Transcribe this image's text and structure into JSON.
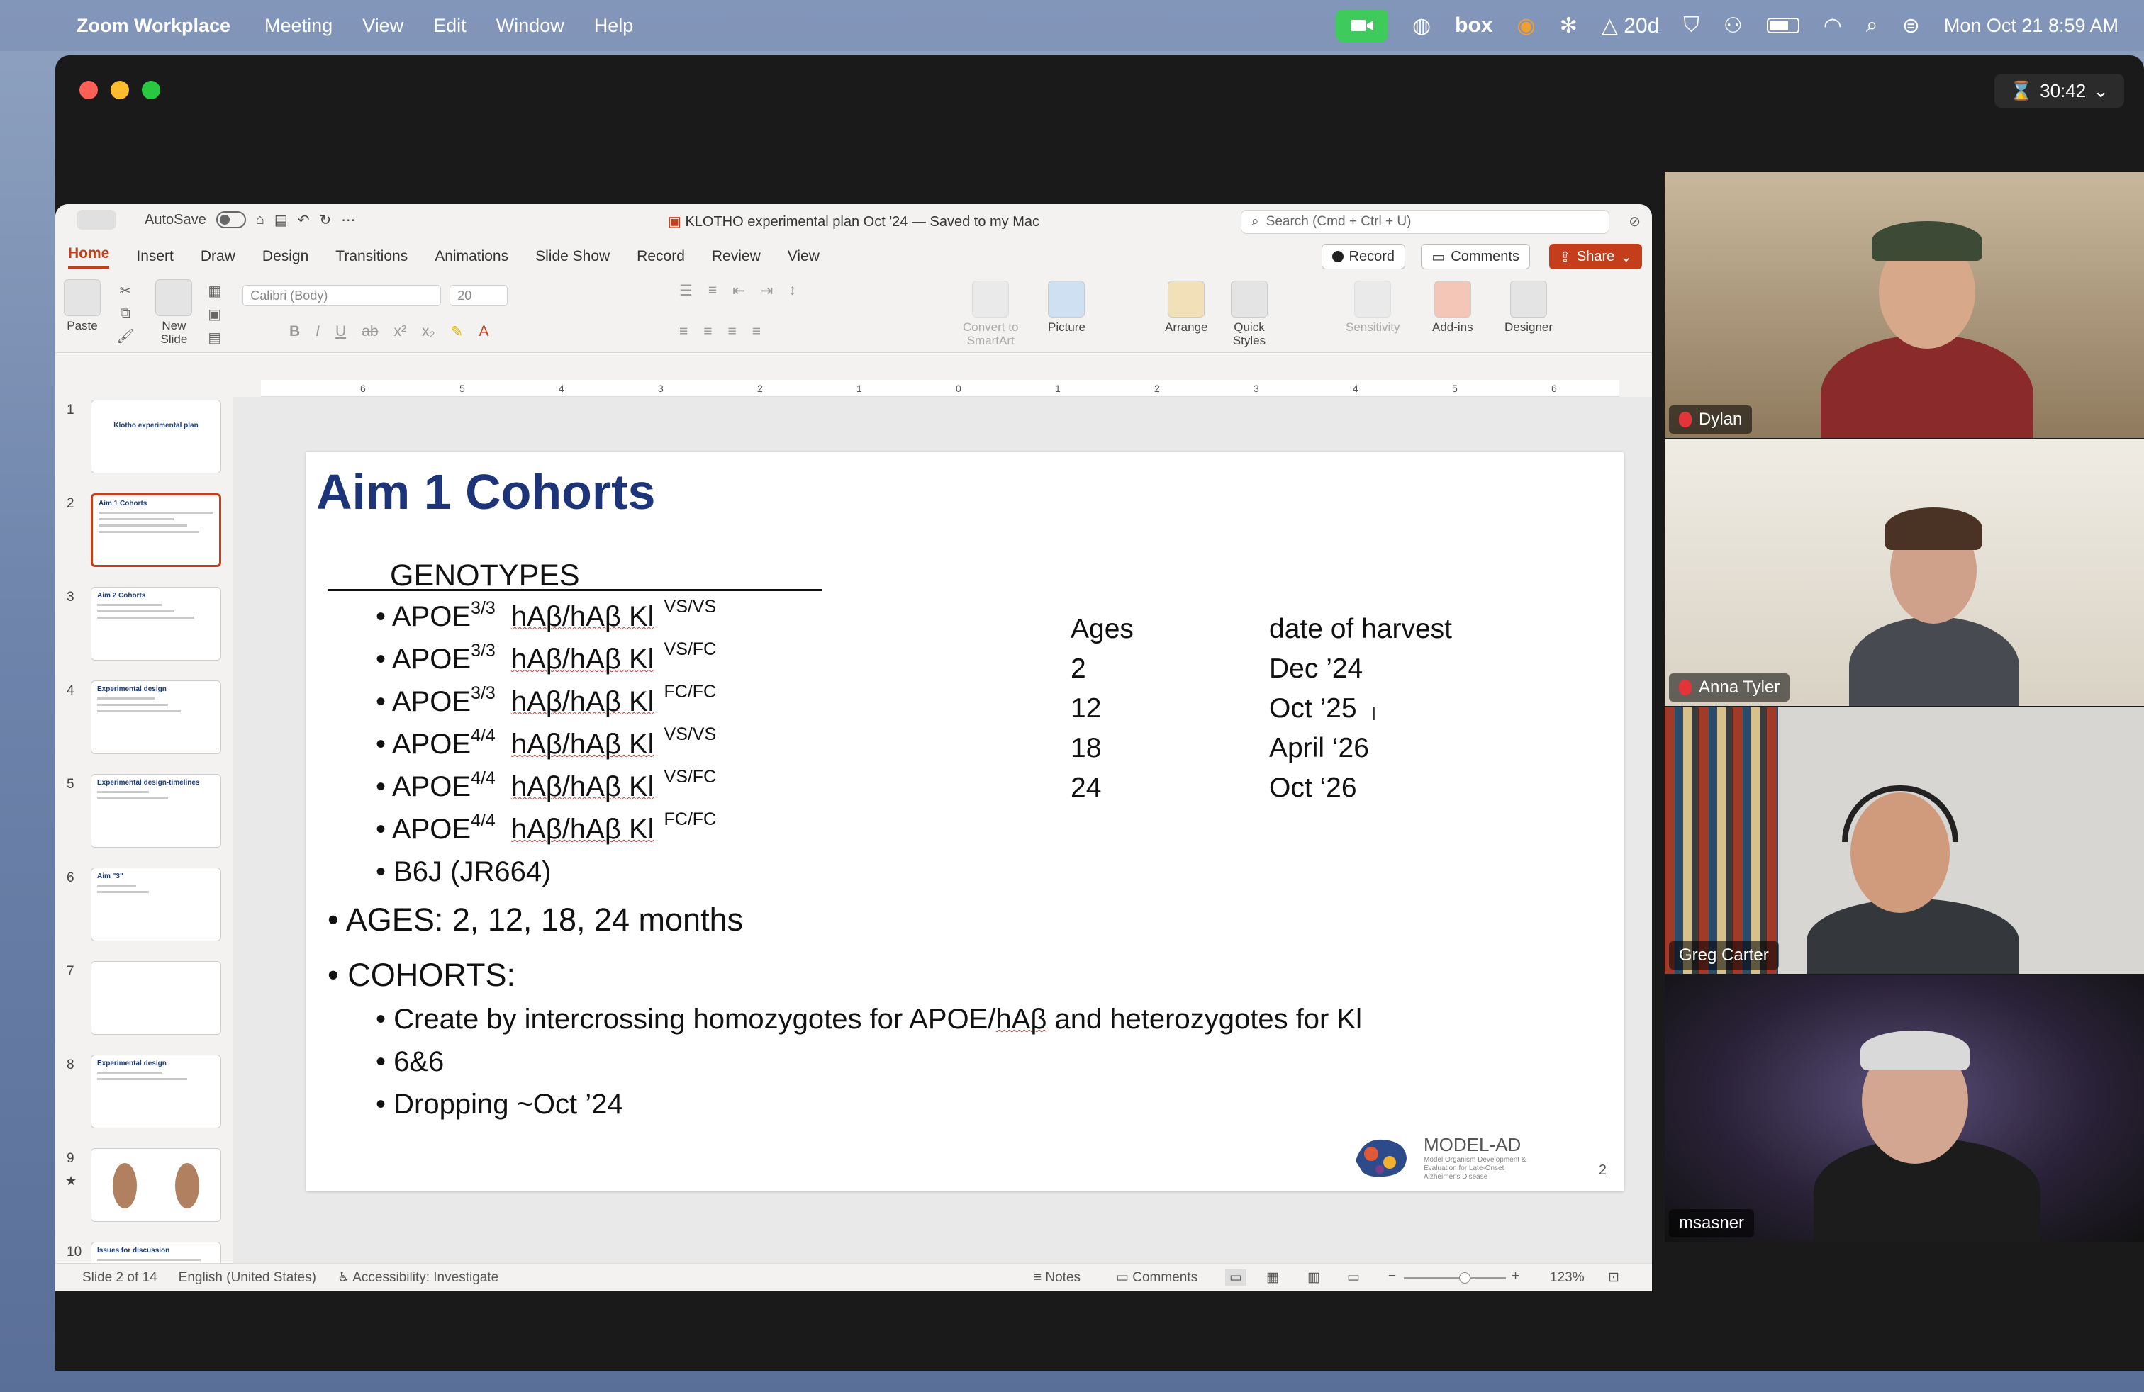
{
  "menubar": {
    "app_name": "Zoom Workplace",
    "menus": [
      "Meeting",
      "View",
      "Edit",
      "Window",
      "Help"
    ],
    "tray_box": "box",
    "tray_counter": "20d",
    "datetime": "Mon Oct 21  8:59 AM"
  },
  "zoom": {
    "timer": "30:42"
  },
  "ppt": {
    "autosave_label": "AutoSave",
    "doc_title": "KLOTHO experimental plan Oct '24 — Saved to my Mac",
    "search_placeholder": "Search (Cmd + Ctrl + U)",
    "tabs": [
      "Home",
      "Insert",
      "Draw",
      "Design",
      "Transitions",
      "Animations",
      "Slide Show",
      "Record",
      "Review",
      "View"
    ],
    "record_button": "Record",
    "comments_button": "Comments",
    "share_button": "Share",
    "ribbon": {
      "paste": "Paste",
      "new_slide": "New\nSlide",
      "font": "Calibri (Body)",
      "font_size": "20",
      "convert_smartart": "Convert to\nSmartArt",
      "picture": "Picture",
      "arrange": "Arrange",
      "quick_styles": "Quick\nStyles",
      "sensitivity": "Sensitivity",
      "addins": "Add-ins",
      "designer": "Designer"
    },
    "ruler_ticks": [
      "6",
      "5",
      "4",
      "3",
      "2",
      "1",
      "0",
      "1",
      "2",
      "3",
      "4",
      "5",
      "6"
    ],
    "thumbnails": [
      {
        "num": "1",
        "title": "Klotho experimental plan"
      },
      {
        "num": "2",
        "title": "Aim 1 Cohorts"
      },
      {
        "num": "3",
        "title": "Aim 2 Cohorts"
      },
      {
        "num": "4",
        "title": "Experimental design"
      },
      {
        "num": "5",
        "title": "Experimental design-timelines"
      },
      {
        "num": "6",
        "title": "Aim \"3\""
      },
      {
        "num": "7",
        "title": ""
      },
      {
        "num": "8",
        "title": "Experimental design"
      },
      {
        "num": "9",
        "title": ""
      },
      {
        "num": "10",
        "title": "Issues for discussion"
      }
    ],
    "status": {
      "slide_of": "Slide 2 of 14",
      "language": "English (United States)",
      "accessibility": "Accessibility: Investigate",
      "notes": "Notes",
      "comments": "Comments",
      "zoom": "123%"
    }
  },
  "slide": {
    "title": "Aim 1 Cohorts",
    "genotypes_header": "GENOTYPES",
    "genotypes": [
      {
        "apoe": "3/3",
        "allele": "VS/VS"
      },
      {
        "apoe": "3/3",
        "allele": "VS/FC"
      },
      {
        "apoe": "3/3",
        "allele": "FC/FC"
      },
      {
        "apoe": "4/4",
        "allele": "VS/VS"
      },
      {
        "apoe": "4/4",
        "allele": "VS/FC"
      },
      {
        "apoe": "4/4",
        "allele": "FC/FC"
      }
    ],
    "apoe_prefix": "APOE",
    "hab_text": "hAβ/hAβ Kl",
    "b6j": "B6J (JR664)",
    "ages": "AGES: 2, 12, 18, 24 months",
    "cohorts": "COHORTS:",
    "cohort_items": [
      "Create by intercrossing homozygotes for APOE/hAβ and heterozygotes for Kl",
      "6&6",
      "Dropping ~Oct ’24"
    ],
    "table": {
      "headers": [
        "Ages",
        "date of harvest"
      ],
      "rows": [
        [
          "2",
          "Dec ’24"
        ],
        [
          "12",
          "Oct ’25"
        ],
        [
          "18",
          "April ‘26"
        ],
        [
          "24",
          "Oct ‘26"
        ]
      ]
    },
    "logo_text": "MODEL-AD",
    "logo_sub": "Model Organism Development & Evaluation for Late-Onset Alzheimer's Disease",
    "page_number": "2"
  },
  "participants": [
    {
      "name": "Dylan"
    },
    {
      "name": "Anna Tyler"
    },
    {
      "name": "Greg Carter"
    },
    {
      "name": "msasner"
    }
  ],
  "colors": {
    "accent_red": "#c43e1c",
    "title_blue": "#1d3578",
    "active_speaker": "#3ecb5c"
  }
}
